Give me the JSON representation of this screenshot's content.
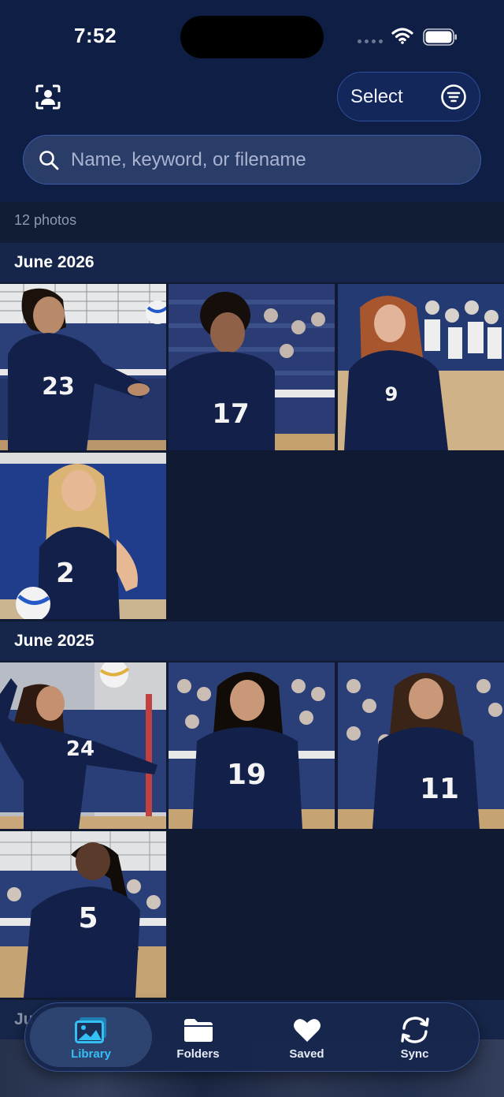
{
  "status_bar": {
    "time": "7:52"
  },
  "header": {
    "select_label": "Select",
    "search_placeholder": "Name, keyword, or filename"
  },
  "library": {
    "count_text": "12 photos",
    "sections": [
      {
        "title": "June 2026",
        "photos": [
          {
            "jersey": "23"
          },
          {
            "jersey": "17"
          },
          {
            "jersey": "9"
          },
          {
            "jersey": "2"
          }
        ]
      },
      {
        "title": "June 2025",
        "photos": [
          {
            "jersey": "24"
          },
          {
            "jersey": "19"
          },
          {
            "jersey": "11"
          },
          {
            "jersey": "5"
          }
        ]
      }
    ],
    "peek_section_title": "Ju"
  },
  "tab_bar": {
    "active": "library",
    "tabs": [
      {
        "id": "library",
        "label": "Library",
        "icon": "photos-icon"
      },
      {
        "id": "folders",
        "label": "Folders",
        "icon": "folder-icon"
      },
      {
        "id": "saved",
        "label": "Saved",
        "icon": "heart-icon"
      },
      {
        "id": "sync",
        "label": "Sync",
        "icon": "sync-icon"
      }
    ]
  },
  "colors": {
    "background": "#101b33",
    "header": "#0f1e44",
    "accent": "#35c0f5",
    "jersey": "#13204a"
  }
}
